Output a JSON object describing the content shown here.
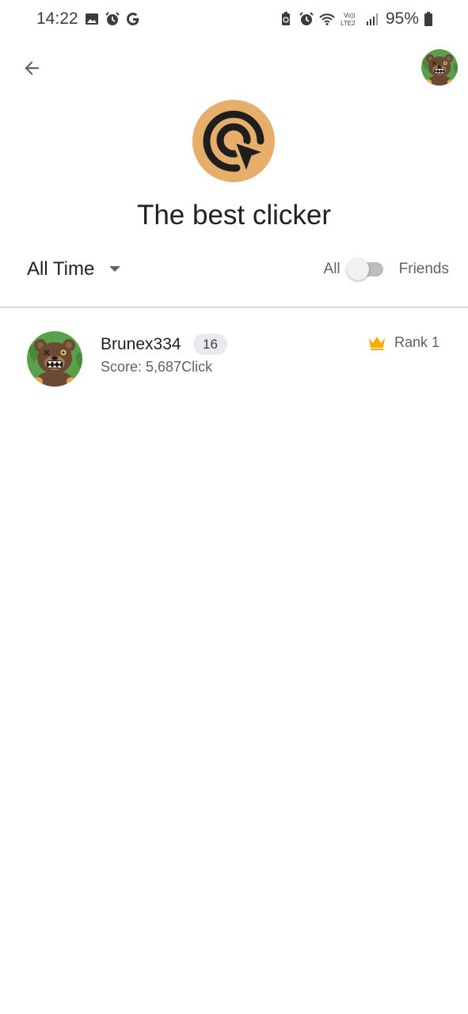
{
  "status_bar": {
    "time": "14:22",
    "battery_percent": "95%",
    "left_icons": [
      "gallery-icon",
      "alarm-icon",
      "google-icon"
    ],
    "right_icons": [
      "battery-saver-icon",
      "alarm-icon",
      "wifi-icon",
      "volte-icon",
      "signal-icon",
      "battery-icon"
    ],
    "volte_label": "Vo)) LTE2"
  },
  "app_bar": {
    "back_icon": "arrow-back-icon",
    "player_avatar_icon": "bear-avatar-icon"
  },
  "game": {
    "icon": "click-target-icon",
    "title": "The best clicker"
  },
  "filter": {
    "time_range": "All Time",
    "dropdown_icon": "dropdown-arrow-icon"
  },
  "toggle": {
    "left_label": "All",
    "right_label": "Friends",
    "state": "All"
  },
  "leaderboard": {
    "rows": [
      {
        "name": "Brunex334",
        "level": "16",
        "score": "Score: 5,687Click",
        "rank": "Rank 1",
        "rank_icon": "crown-icon"
      }
    ]
  },
  "colors": {
    "game_icon_bg": "#e6ae6a",
    "crown": "#f9ab00",
    "divider": "#dadce0",
    "avatar_bg": "#5aa04a"
  }
}
